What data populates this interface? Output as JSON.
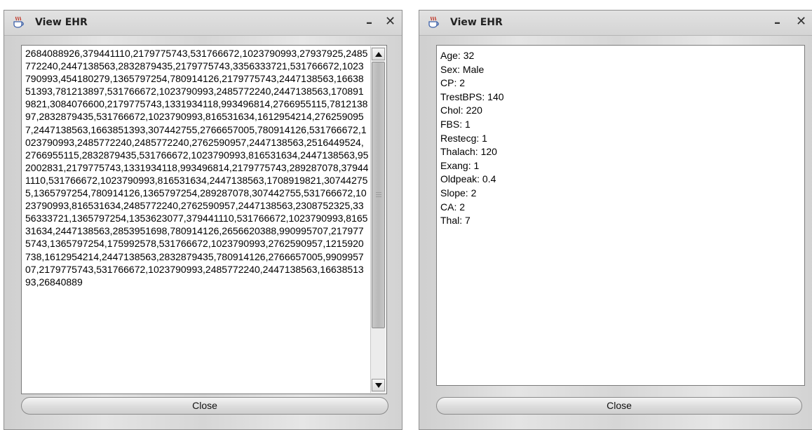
{
  "left_window": {
    "title": "View EHR",
    "minimize_glyph": "–",
    "close_glyph": "✕",
    "encrypted_text": "2684088926,379441110,2179775743,531766672,1023790993,27937925,2485772240,2447138563,2832879435,2179775743,3356333721,531766672,1023790993,454180279,1365797254,780914126,2179775743,2447138563,1663851393,781213897,531766672,1023790993,2485772240,2447138563,1708919821,3084076600,2179775743,1331934118,993496814,2766955115,781213897,2832879435,531766672,1023790993,816531634,1612954214,2762590957,2447138563,1663851393,307442755,2766657005,780914126,531766672,1023790993,2485772240,2485772240,2762590957,2447138563,2516449524,2766955115,2832879435,531766672,1023790993,816531634,2447138563,952002831,2179775743,1331934118,993496814,2179775743,289287078,379441110,531766672,1023790993,816531634,2447138563,1708919821,307442755,1365797254,780914126,1365797254,289287078,307442755,531766672,1023790993,816531634,2485772240,2762590957,2447138563,2308752325,3356333721,1365797254,1353623077,379441110,531766672,1023790993,816531634,2447138563,2853951698,780914126,2656620388,990995707,2179775743,1365797254,175992578,531766672,1023790993,2762590957,1215920738,1612954214,2447138563,2832879435,780914126,2766657005,990995707,2179775743,531766672,1023790993,2485772240,2447138563,1663851393,26840889",
    "close_label": "Close"
  },
  "right_window": {
    "title": "View EHR",
    "minimize_glyph": "–",
    "close_glyph": "✕",
    "fields": [
      "Age: 32",
      "Sex: Male",
      "CP: 2",
      "TrestBPS: 140",
      "Chol: 220",
      "FBS: 1",
      "Restecg: 1",
      "Thalach: 120",
      "Exang: 1",
      "Oldpeak: 0.4",
      "Slope: 2",
      "CA: 2",
      "Thal: 7"
    ],
    "close_label": "Close"
  },
  "icons": {
    "app_icon": "java-coffee-cup-icon",
    "scroll_up": "arrow-up-icon",
    "scroll_down": "arrow-down-icon"
  }
}
